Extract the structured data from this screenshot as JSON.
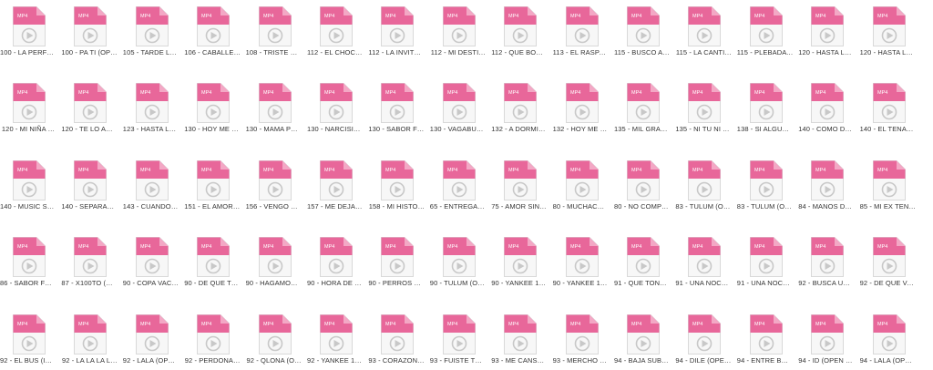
{
  "file_type_label": "MP4",
  "colors": {
    "icon_header": "#e8679a",
    "icon_fold": "#f3a8c5",
    "icon_body": "#f7f7f7",
    "icon_border": "#d9d9d9",
    "play_circle": "#c8c8c8",
    "label_text": "#333333"
  },
  "icons": {
    "file": "mp4-file-icon",
    "play": "play-icon"
  },
  "files": [
    "100 - LA PERFE…",
    "100 - PA TI (OPE…",
    "105 - TARDE LO…",
    "106 - CABALLER…",
    "108 - TRISTE RE…",
    "112 - EL CHOCH…",
    "112 - LA INVITE …",
    "112 - MI DESTI…",
    "112 - QUE BONI…",
    "113 - EL RASPA…",
    "115 - BUSCO AL…",
    "115 - LA CANTI…",
    "115 - PLEBADA …",
    "120 - HASTA LA …",
    "120 - HASTA LA …",
    "120 - MI NIÑA …",
    "120 - TE LO AG…",
    "123 - HASTA LA …",
    "130 - HOY ME E…",
    "130 - MAMA PE…",
    "130 - NARCISIS…",
    "130 - SABOR FR…",
    "130 - VAGABUN…",
    "132 - A DORMIR…",
    "132 - HOY ME D…",
    "135 - MIL GRAC…",
    "135 - NI TU NI Y…",
    "138 - SI ALGUN …",
    "140 - COMO DU…",
    "140 - EL TENAM…",
    "140 - MUSIC SE…",
    "140 - SEPARAD…",
    "143 - CUANDO …",
    "151 - EL AMOR …",
    "156 - VENGO D…",
    "157 - ME DEJAS…",
    "158 - MI HISTO…",
    "65 - ENTREGAM…",
    "75 - AMOR SIN …",
    "80 - MUCHACHI…",
    "80 - NO COMPR…",
    "83 - TULUM (OP…",
    "83 - TULUM (OP…",
    "84 - MANOS DE …",
    "85 - MI EX TENI…",
    "86 - SABOR FRE…",
    "87 - X100TO (O…",
    "90 - COPA VACI…",
    "90 - DE QUE TE …",
    "90 - HAGAMOS …",
    "90 - HORA DE S…",
    "90 - PERROS SA…",
    "90 - TULUM (OP…",
    "90 - YANKEE 15…",
    "90 - YANKEE 15…",
    "91 - QUE TONT…",
    "91 - UNA NOCH…",
    "91 - UNA NOCH…",
    "92 - BUSCA UN …",
    "92 - DE QUE VA…",
    "92 - EL BUS (IN…",
    "92 - LA LA LA L…",
    "92 - LALA (OPE…",
    "92 - PERDONA…",
    "92 - QLONA (O…",
    "92 - YANKEE 15…",
    "93 - CORAZON …",
    "93 - FUISTE TU (…",
    "93 - ME CANSE …",
    "93 - MERCHO R…",
    "94 - BAJA SUBE …",
    "94 - DILE (OPEN…",
    "94 - ENTRE BOT…",
    "94 - ID (OPEN S…",
    "94 - LALA (OPE…"
  ]
}
